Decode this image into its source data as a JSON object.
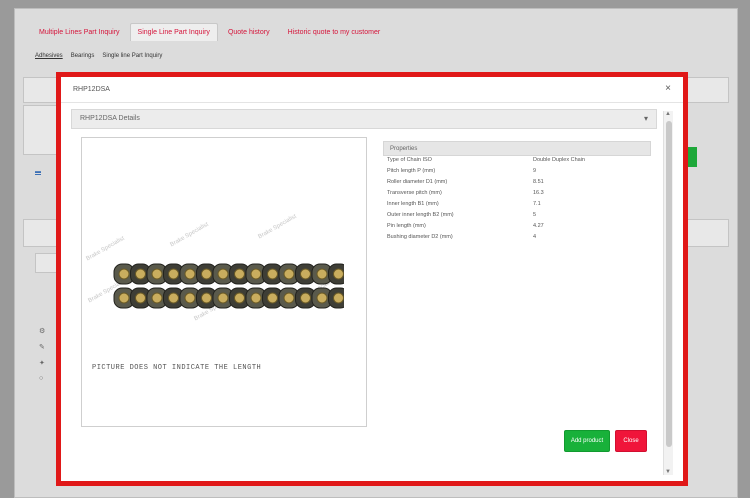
{
  "tabs": [
    {
      "label": "Multiple Lines Part Inquiry"
    },
    {
      "label": "Single Line Part Inquiry"
    },
    {
      "label": "Quote history"
    },
    {
      "label": "Historic quote to my customer"
    }
  ],
  "subtabs": [
    {
      "label": "Adhesives"
    },
    {
      "label": "Bearings"
    },
    {
      "label": "Single line Part Inquiry"
    }
  ],
  "modal": {
    "title": "RHP12DSA",
    "close_glyph": "×",
    "accordion_title": "RHP12DSA Details",
    "chevron_glyph": "▾",
    "image": {
      "watermark_text": "Brake Specialist",
      "caption": "PICTURE DOES NOT INDICATE THE LENGTH"
    },
    "properties_header": "Properties",
    "properties": [
      {
        "name": "Type of Chain ISO",
        "value": "Double Duplex Chain"
      },
      {
        "name": "Pitch length P (mm)",
        "value": "9"
      },
      {
        "name": "Roller diameter D1 (mm)",
        "value": "8.51"
      },
      {
        "name": "Transverse pitch (mm)",
        "value": "16.3"
      },
      {
        "name": "Inner length B1 (mm)",
        "value": "7.1"
      },
      {
        "name": "Outer inner length B2 (mm)",
        "value": "5"
      },
      {
        "name": "Pin length (mm)",
        "value": "4.27"
      },
      {
        "name": "Bushing diameter D2 (mm)",
        "value": "4"
      }
    ],
    "buttons": {
      "primary": "Add product",
      "secondary": "Close"
    }
  },
  "colors": {
    "highlight": "#e01818",
    "tab_text": "#d5143a",
    "primary_button": "#18b13a",
    "secondary_button": "#f0153a"
  }
}
